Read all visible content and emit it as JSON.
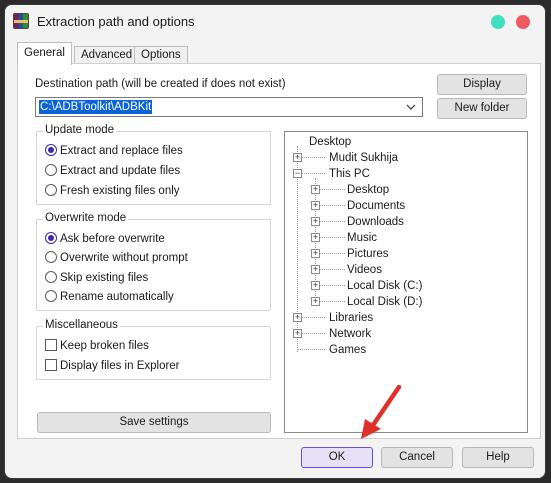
{
  "window": {
    "title": "Extraction path and options"
  },
  "tabs": [
    "General",
    "Advanced",
    "Options"
  ],
  "destination": {
    "label": "Destination path (will be created if does not exist)",
    "value": "C:\\ADBToolkit\\ADBKit"
  },
  "side_buttons": {
    "display": "Display",
    "new_folder": "New folder"
  },
  "update_mode": {
    "title": "Update mode",
    "options": [
      "Extract and replace files",
      "Extract and update files",
      "Fresh existing files only"
    ],
    "selected_index": 0
  },
  "overwrite_mode": {
    "title": "Overwrite mode",
    "options": [
      "Ask before overwrite",
      "Overwrite without prompt",
      "Skip existing files",
      "Rename automatically"
    ],
    "selected_index": 0
  },
  "miscellaneous": {
    "title": "Miscellaneous",
    "options": [
      "Keep broken files",
      "Display files in Explorer"
    ]
  },
  "save_settings": "Save settings",
  "tree": {
    "root": "Desktop",
    "items": [
      "Mudit Sukhija",
      "This PC",
      "Desktop",
      "Documents",
      "Downloads",
      "Music",
      "Pictures",
      "Videos",
      "Local Disk (C:)",
      "Local Disk (D:)",
      "Libraries",
      "Network",
      "Games"
    ]
  },
  "footer": {
    "ok": "OK",
    "cancel": "Cancel",
    "help": "Help"
  },
  "colors": {
    "accent": "#3a2bb0",
    "selection": "#0a64d8",
    "arrow": "#e0302a"
  }
}
